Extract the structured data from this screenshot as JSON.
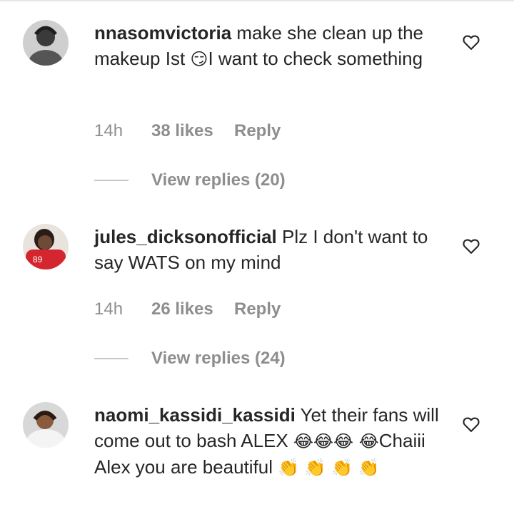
{
  "comments": [
    {
      "username": "nnasomvictoria",
      "text_1": " make she clean up the makeup Ist ",
      "emoji_1": "😏",
      "text_2": "I want to check something",
      "time": "14h",
      "likes": "38 likes",
      "reply": "Reply",
      "view_replies": "View replies (20)"
    },
    {
      "username": "jules_dicksonofficial",
      "text_1": " Plz I don't want to say WATS on my mind",
      "time": "14h",
      "likes": "26 likes",
      "reply": "Reply",
      "view_replies": "View replies (24)"
    },
    {
      "username": "naomi_kassidi_kassidi",
      "text_1": " Yet their fans will come out to bash ALEX ",
      "emoji_1": "😂😂😂 😂",
      "text_2": "Chaiii Alex you are beautiful ",
      "emoji_2": "👏 👏 👏 👏"
    }
  ],
  "icons": {
    "like": "heart-outline-icon"
  }
}
